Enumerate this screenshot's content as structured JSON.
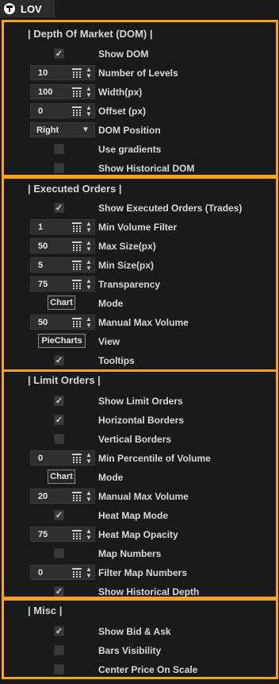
{
  "tab": {
    "title": "LOV"
  },
  "sections": {
    "dom": {
      "title": "| Depth Of Market (DOM) |",
      "show_dom": {
        "label": "Show DOM",
        "checked": true
      },
      "levels": {
        "label": "Number of Levels",
        "value": "10"
      },
      "width": {
        "label": "Width(px)",
        "value": "100"
      },
      "offset": {
        "label": "Offset (px)",
        "value": "0"
      },
      "position": {
        "label": "DOM Position",
        "value": "Right"
      },
      "gradients": {
        "label": "Use gradients",
        "checked": false
      },
      "historical": {
        "label": "Show Historical DOM",
        "checked": false
      }
    },
    "executed": {
      "title": "| Executed Orders |",
      "show": {
        "label": "Show Executed Orders (Trades)",
        "checked": true
      },
      "min_volume": {
        "label": "Min Volume Filter",
        "value": "1"
      },
      "max_size": {
        "label": "Max Size(px)",
        "value": "50"
      },
      "min_size": {
        "label": "Min Size(px)",
        "value": "5"
      },
      "transparency": {
        "label": "Transparency",
        "value": "75"
      },
      "mode": {
        "label": "Mode",
        "value": "Chart"
      },
      "manual_max": {
        "label": "Manual Max Volume",
        "value": "50"
      },
      "view": {
        "label": "View",
        "value": "PieCharts"
      },
      "tooltips": {
        "label": "Tooltips",
        "checked": true
      }
    },
    "limit": {
      "title": "| Limit Orders |",
      "show": {
        "label": "Show Limit Orders",
        "checked": true
      },
      "horizontal": {
        "label": "Horizontal Borders",
        "checked": true
      },
      "vertical": {
        "label": "Vertical Borders",
        "checked": false
      },
      "min_percentile": {
        "label": "Min Percentile of Volume",
        "value": "0"
      },
      "mode": {
        "label": "Mode",
        "value": "Chart"
      },
      "manual_max": {
        "label": "Manual Max Volume",
        "value": "20"
      },
      "heatmap": {
        "label": "Heat Map Mode",
        "checked": true
      },
      "opacity": {
        "label": "Heat Map Opacity",
        "value": "75"
      },
      "map_numbers": {
        "label": "Map Numbers",
        "checked": false
      },
      "filter_numbers": {
        "label": "Filter Map Numbers",
        "value": "0"
      },
      "historical_depth": {
        "label": "Show Historical Depth",
        "checked": true
      }
    },
    "misc": {
      "title": "| Misc |",
      "bid_ask": {
        "label": "Show Bid & Ask",
        "checked": true
      },
      "bars": {
        "label": "Bars Visibility",
        "checked": false
      },
      "center": {
        "label": "Center Price On Scale",
        "checked": false
      }
    }
  }
}
